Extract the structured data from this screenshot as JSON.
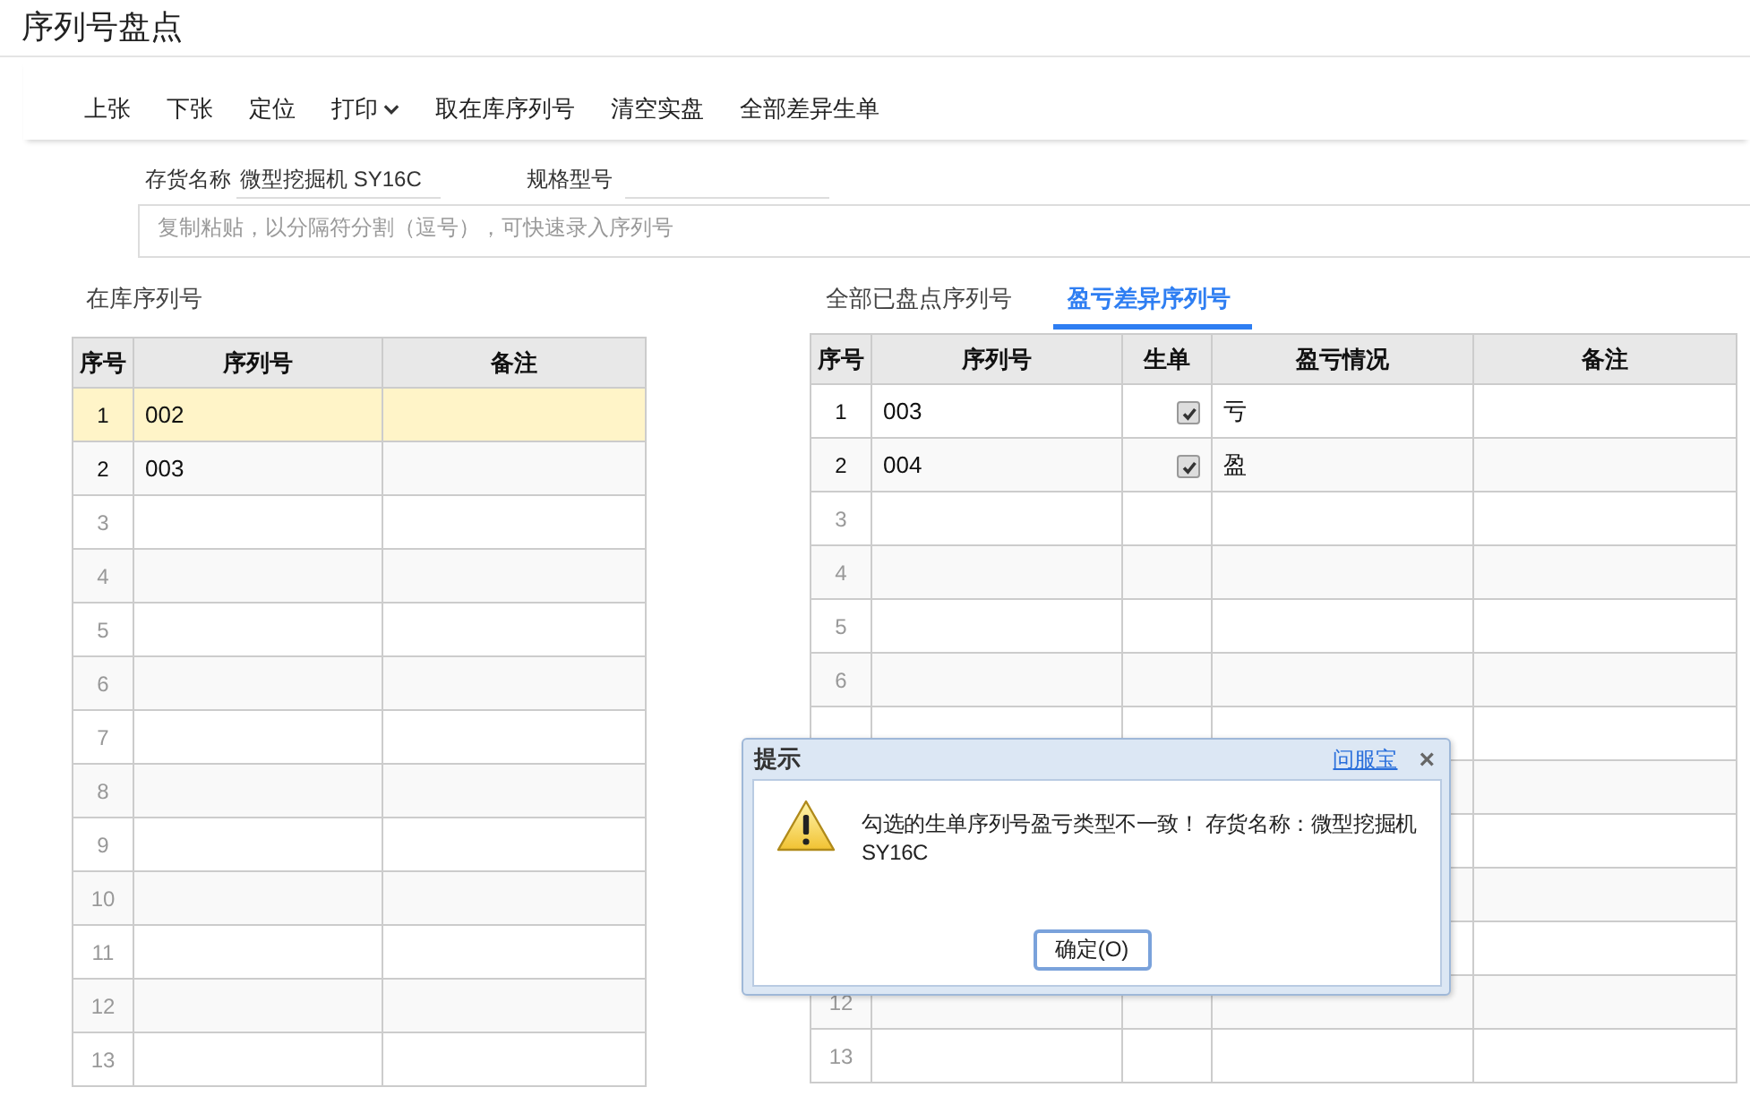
{
  "page_title": "序列号盘点",
  "toolbar": [
    {
      "label": "上张"
    },
    {
      "label": "下张"
    },
    {
      "label": "定位"
    },
    {
      "label": "打印",
      "dropdown": true
    },
    {
      "label": "取在库序列号"
    },
    {
      "label": "清空实盘"
    },
    {
      "label": "全部差异生单"
    }
  ],
  "fields": [
    {
      "label": "存货名称",
      "value": "微型挖掘机 SY16C"
    },
    {
      "label": "规格型号"
    }
  ],
  "paste_box": {
    "placeholder": "复制粘贴，以分隔符分割（逗号），可快速录入序列号"
  },
  "left_panel": {
    "title": "在库序列号",
    "columns": [
      "序号",
      "序列号",
      "备注"
    ],
    "rows": [
      {
        "no": "1",
        "serial": "002",
        "selected": true
      },
      {
        "no": "2",
        "serial": "003",
        "selected": false
      },
      {
        "no": "3",
        "selected": false
      },
      {
        "no": "4",
        "selected": false
      },
      {
        "no": "5",
        "selected": false
      },
      {
        "no": "6",
        "selected": false
      },
      {
        "no": "7",
        "selected": false
      },
      {
        "no": "8",
        "selected": false
      },
      {
        "no": "9",
        "selected": false
      },
      {
        "no": "10",
        "selected": false
      },
      {
        "no": "11",
        "selected": false
      },
      {
        "no": "12",
        "selected": false
      },
      {
        "no": "13",
        "selected": false
      }
    ]
  },
  "right_panel": {
    "tabs": [
      {
        "label": "全部已盘点序列号",
        "selected": false
      },
      {
        "label": "盈亏差异序列号",
        "selected": true
      }
    ],
    "columns": [
      "序号",
      "序列号",
      "生单",
      "盈亏情况",
      "备注"
    ],
    "rows": [
      {
        "no": "1",
        "serial": "003",
        "checked": true,
        "diff": "亏"
      },
      {
        "no": "2",
        "serial": "004",
        "checked": true,
        "diff": "盈"
      },
      {
        "no": "3"
      },
      {
        "no": "4"
      },
      {
        "no": "5"
      },
      {
        "no": "6"
      },
      {},
      {},
      {},
      {},
      {},
      {
        "no": "12"
      },
      {
        "no": "13"
      }
    ]
  },
  "dialog": {
    "title": "提示",
    "link": "问服宝",
    "close": "×",
    "message": "勾选的生单序列号盈亏类型不一致！ 存货名称：微型挖掘机 SY16C",
    "button": "确定(O)"
  }
}
